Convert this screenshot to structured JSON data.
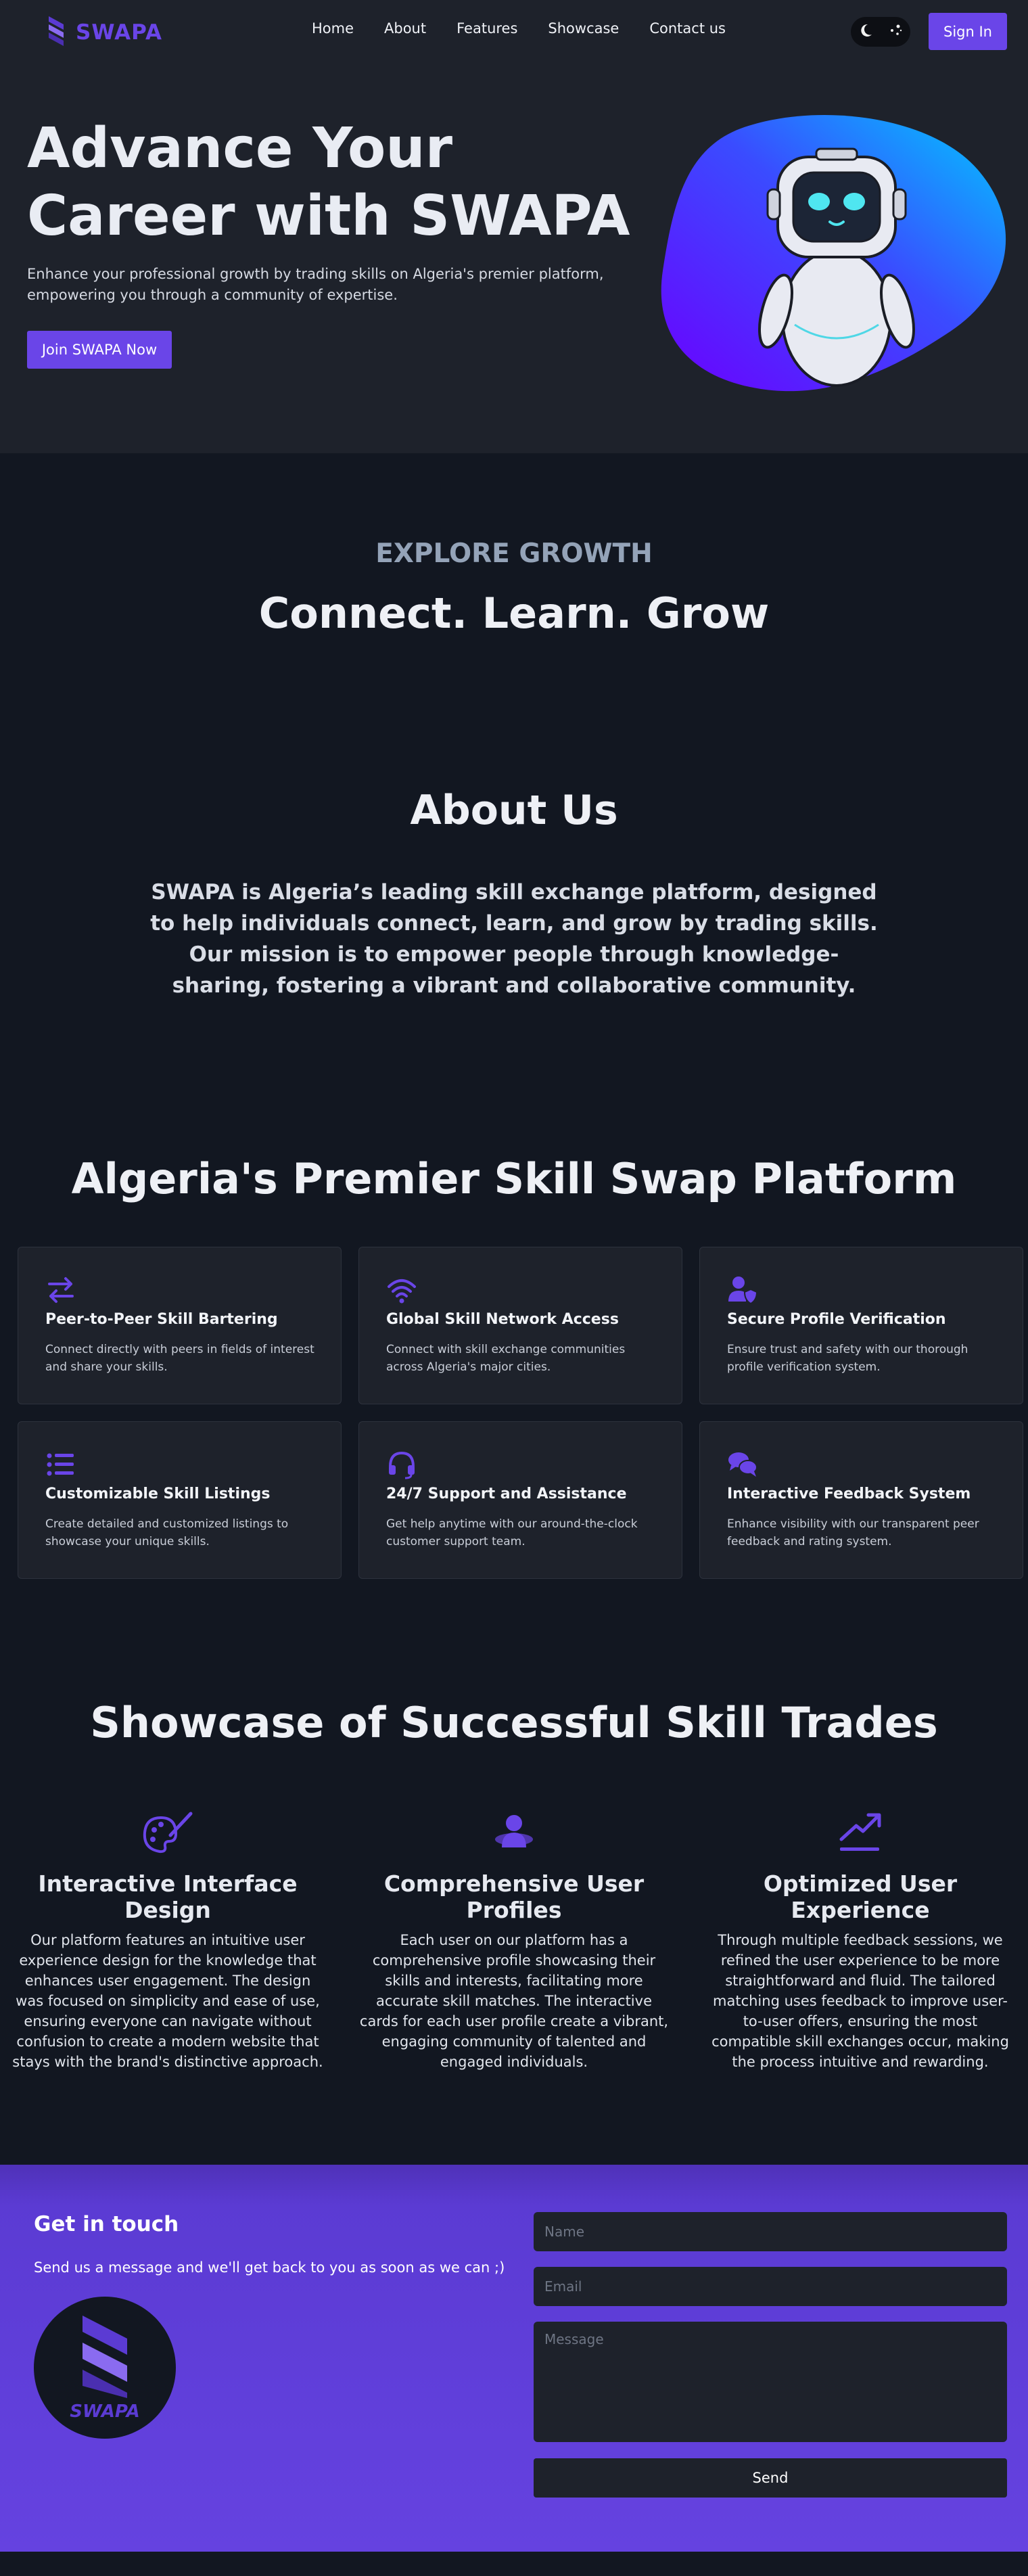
{
  "nav": {
    "brand": "SWAPA",
    "links": [
      "Home",
      "About",
      "Features",
      "Showcase",
      "Contact us"
    ],
    "signin_label": "Sign In",
    "icons": {
      "logo": "swapa-s-logo",
      "moon": "moon-icon",
      "sparkles": "sparkles-icon"
    }
  },
  "hero": {
    "title": "Advance Your Career with SWAPA",
    "subtitle": "Enhance your professional growth by trading skills on Algeria's premier platform, empowering you through a community of expertise.",
    "button_label": "Join SWAPA Now",
    "art": "robot-mascot-illustration"
  },
  "explore": {
    "eyebrow": "EXPLORE GROWTH",
    "title": "Connect. Learn. Grow"
  },
  "about": {
    "title": "About Us",
    "text": "SWAPA is Algeria’s leading skill exchange platform, designed to help individuals connect, learn, and grow by trading skills. Our mission is to empower people through knowledge-sharing, fostering a vibrant and collaborative community."
  },
  "features": {
    "title": "Algeria's Premier Skill Swap Platform",
    "cards": [
      {
        "icon": "swap-arrows-icon",
        "title": "Peer-to-Peer Skill Bartering",
        "desc": "Connect directly with peers in fields of interest and share your skills."
      },
      {
        "icon": "wifi-icon",
        "title": "Global Skill Network Access",
        "desc": "Connect with skill exchange communities across Algeria's major cities."
      },
      {
        "icon": "user-shield-icon",
        "title": "Secure Profile Verification",
        "desc": "Ensure trust and safety with our thorough profile verification system."
      },
      {
        "icon": "list-icon",
        "title": "Customizable Skill Listings",
        "desc": "Create detailed and customized listings to showcase your unique skills."
      },
      {
        "icon": "headset-icon",
        "title": "24/7 Support and Assistance",
        "desc": "Get help anytime with our around-the-clock customer support team."
      },
      {
        "icon": "chat-bubbles-icon",
        "title": "Interactive Feedback System",
        "desc": "Enhance visibility with our transparent peer feedback and rating system."
      }
    ]
  },
  "showcase": {
    "title": "Showcase of Successful Skill Trades",
    "items": [
      {
        "icon": "palette-brush-icon",
        "title": "Interactive Interface Design",
        "desc": "Our platform features an intuitive user experience design for the knowledge that enhances user engagement. The design was focused on simplicity and ease of use, ensuring everyone can navigate without confusion to create a modern website that stays with the brand's distinctive approach."
      },
      {
        "icon": "user-profile-icon",
        "title": "Comprehensive User Profiles",
        "desc": "Each user on our platform has a comprehensive profile showcasing their skills and interests, facilitating more accurate skill matches. The interactive cards for each user profile create a vibrant, engaging community of talented and engaged individuals."
      },
      {
        "icon": "trend-up-icon",
        "title": "Optimized User Experience",
        "desc": "Through multiple feedback sessions, we refined the user experience to be more straightforward and fluid. The tailored matching uses feedback to improve user-to-user offers, ensuring the most compatible skill exchanges occur, making the process intuitive and rewarding."
      }
    ]
  },
  "contact": {
    "title": "Get in touch",
    "subtitle": "Send us a message and we'll get back to you as soon as we can ;)",
    "logo_text": "SWAPA",
    "name_placeholder": "Name",
    "email_placeholder": "Email",
    "message_placeholder": "Message",
    "send_label": "Send"
  },
  "colors": {
    "accent": "#6a45e8",
    "bg": "#121721",
    "panel": "#1e222b"
  }
}
